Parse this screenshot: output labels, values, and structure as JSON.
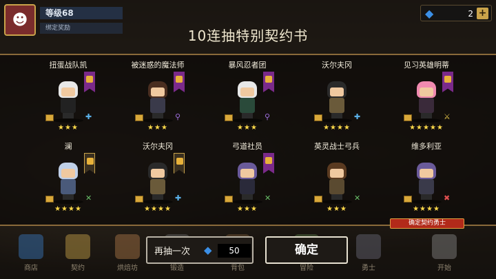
{
  "player": {
    "level": "等级68",
    "sub": "绑定奖励"
  },
  "currency": {
    "gems": "2"
  },
  "title": "10连抽特别契约书",
  "heroes": [
    {
      "name": "扭蛋战队凯",
      "stars": 3,
      "banner": "purple",
      "hair": "#e8e8e8",
      "body": "#222222",
      "weapon": "axe-icon"
    },
    {
      "name": "被迷惑的魔法师",
      "stars": 3,
      "banner": "purple",
      "hair": "#4a2e20",
      "body": "#3a3a4a",
      "weapon": "staff-icon"
    },
    {
      "name": "暴风忍者团",
      "stars": 3,
      "banner": "purple",
      "hair": "#e8e8e8",
      "body": "#2a4a3a",
      "weapon": "staff-icon"
    },
    {
      "name": "沃尔夫冈",
      "stars": 4,
      "banner": "none",
      "hair": "#2a2a2a",
      "body": "#6a5a3a",
      "weapon": "axe-icon"
    },
    {
      "name": "见习英雄明蒂",
      "stars": 5,
      "banner": "purple",
      "hair": "#f08ab0",
      "body": "#3a2a3a",
      "weapon": "sword-icon"
    },
    {
      "name": "澜",
      "stars": 4,
      "banner": "gold",
      "hair": "#c0d0e8",
      "body": "#4a5a7a",
      "weapon": "bow-icon"
    },
    {
      "name": "沃尔夫冈",
      "stars": 4,
      "banner": "gold",
      "hair": "#2a2a2a",
      "body": "#6a5a3a",
      "weapon": "axe-icon"
    },
    {
      "name": "弓道社员",
      "stars": 3,
      "banner": "purple",
      "hair": "#6a5a9a",
      "body": "#2a2a3a",
      "weapon": "bow-icon"
    },
    {
      "name": "英灵战士弓兵",
      "stars": 3,
      "banner": "none",
      "hair": "#5a3a20",
      "body": "#5a4a30",
      "weapon": "bow-icon"
    },
    {
      "name": "维多利亚",
      "stars": 4,
      "banner": "none",
      "hair": "#6a5a9a",
      "body": "#3a3a4a",
      "weapon": "cross-icon"
    }
  ],
  "confirm_tag": "确定契约勇士",
  "nav": [
    {
      "label": "商店",
      "color": "#3a7ac0"
    },
    {
      "label": "契约",
      "color": "#c9a34a"
    },
    {
      "label": "烘焙坊",
      "color": "#b07a4a"
    },
    {
      "label": "锻造",
      "color": "#6a6a6a"
    },
    {
      "label": "背包",
      "color": "#7a5a3a"
    },
    {
      "label": "冒险",
      "color": "#5a7a4a"
    },
    {
      "label": "勇士",
      "color": "#6a6a7a"
    },
    {
      "label": "开始",
      "color": "#8a8a8a"
    }
  ],
  "actions": {
    "again_label": "再抽一次",
    "again_cost": "50",
    "confirm_label": "确定"
  },
  "colors": {
    "star": "#ffd94a",
    "gem": "#3b8fe6",
    "accent": "#c9a34a"
  }
}
